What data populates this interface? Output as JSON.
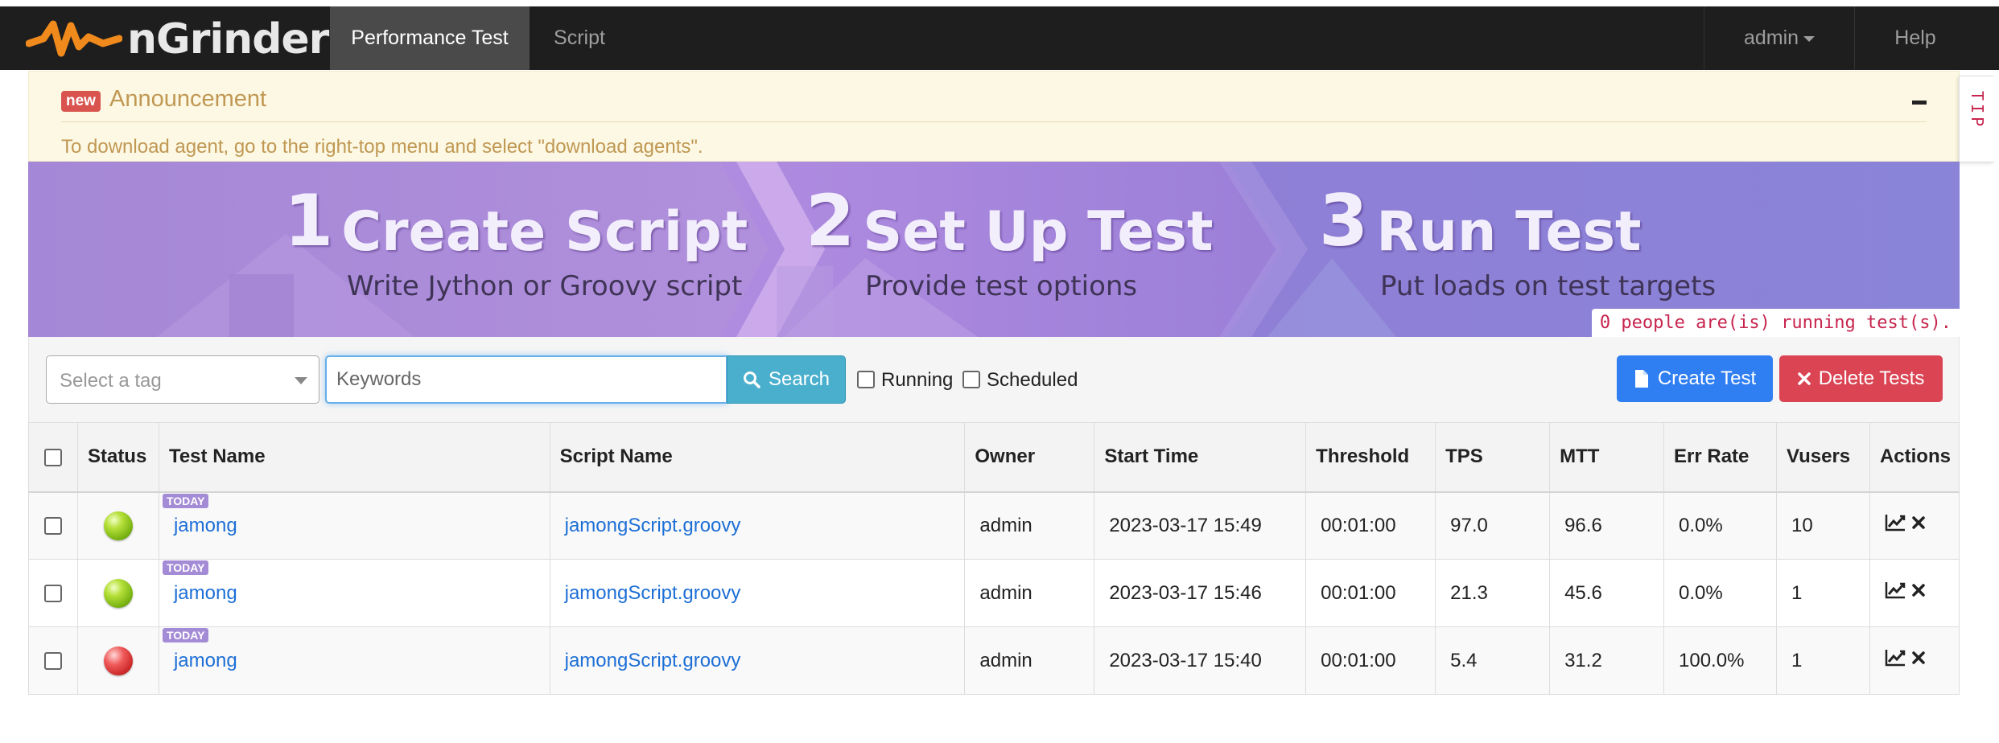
{
  "app": {
    "brand": "nGrinder",
    "nav": {
      "tabs": [
        {
          "label": "Performance Test",
          "active": true
        },
        {
          "label": "Script",
          "active": false
        }
      ],
      "user_menu": "admin",
      "help": "Help"
    }
  },
  "announcement": {
    "badge": "new",
    "title": "Announcement",
    "body": "To download agent, go to the right-top menu and select \"download agents\".",
    "tip_tab": "TIP"
  },
  "banner": {
    "steps": [
      {
        "num": "1",
        "title": "Create Script",
        "subtitle": "Write Jython or Groovy script"
      },
      {
        "num": "2",
        "title": "Set Up Test",
        "subtitle": "Provide test options"
      },
      {
        "num": "3",
        "title": "Run Test",
        "subtitle": "Put loads on test targets"
      }
    ],
    "running_notice": "0 people are(is) running test(s)."
  },
  "toolbar": {
    "tag_placeholder": "Select a tag",
    "keyword_placeholder": "Keywords",
    "keyword_value": "",
    "search_label": "Search",
    "running_label": "Running",
    "scheduled_label": "Scheduled",
    "create_label": "Create Test",
    "delete_label": "Delete Tests"
  },
  "table": {
    "columns": [
      "Status",
      "Test Name",
      "Script Name",
      "Owner",
      "Start Time",
      "Threshold",
      "TPS",
      "MTT",
      "Err Rate",
      "Vusers",
      "Actions"
    ],
    "rows": [
      {
        "badge": "TODAY",
        "status": "finished",
        "test_name": "jamong",
        "script_name": "jamongScript.groovy",
        "owner": "admin",
        "start_time": "2023-03-17 15:49",
        "threshold": "00:01:00",
        "tps": "97.0",
        "mtt": "96.6",
        "err_rate": "0.0%",
        "vusers": "10"
      },
      {
        "badge": "TODAY",
        "status": "finished",
        "test_name": "jamong",
        "script_name": "jamongScript.groovy",
        "owner": "admin",
        "start_time": "2023-03-17 15:46",
        "threshold": "00:01:00",
        "tps": "21.3",
        "mtt": "45.6",
        "err_rate": "0.0%",
        "vusers": "1"
      },
      {
        "badge": "TODAY",
        "status": "error",
        "test_name": "jamong",
        "script_name": "jamongScript.groovy",
        "owner": "admin",
        "start_time": "2023-03-17 15:40",
        "threshold": "00:01:00",
        "tps": "5.4",
        "mtt": "31.2",
        "err_rate": "100.0%",
        "vusers": "1"
      }
    ]
  },
  "colors": {
    "navbar": "#1e1e1e",
    "announcement_bg": "#fcf8e3",
    "announcement_text": "#c09853",
    "banner": "#8d76cf",
    "search_button": "#49afcd",
    "create_button": "#2f7ef2",
    "delete_button": "#da4453",
    "link": "#1d6fd6",
    "status_ok": "#8ccd1f",
    "status_error": "#e03b3b"
  }
}
